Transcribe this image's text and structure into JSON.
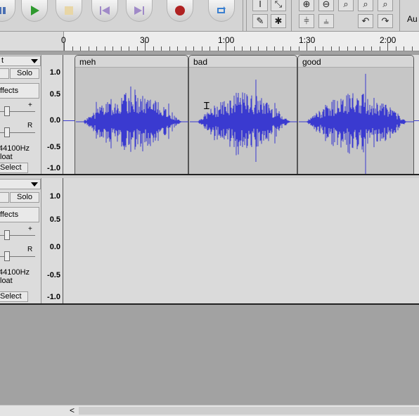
{
  "toolbar": {
    "device_label_partial": "Au"
  },
  "ruler": {
    "labels": [
      "0",
      "30",
      "1:00",
      "1:30",
      "2:00"
    ]
  },
  "tracks": [
    {
      "name_partial": "t",
      "solo_label": "Solo",
      "effects_label": "ffects",
      "gain_plus": "+",
      "pan_right": "R",
      "rate": "44100Hz",
      "format": "loat",
      "select_label": "Select",
      "scale": [
        "1.0",
        "0.5",
        "0.0",
        "-0.5",
        "-1.0"
      ],
      "clips": [
        {
          "name": "meh"
        },
        {
          "name": "bad"
        },
        {
          "name": "good"
        }
      ]
    },
    {
      "solo_label": "Solo",
      "effects_label": "ffects",
      "gain_plus": "+",
      "pan_right": "R",
      "rate": "44100Hz",
      "format": "loat",
      "select_label": "Select",
      "scale": [
        "1.0",
        "0.5",
        "0.0",
        "-0.5",
        "-1.0"
      ]
    }
  ],
  "colors": {
    "waveform": "#3a3ad0",
    "clip_background": "#c6c6c6",
    "record_red": "#b02222",
    "play_green": "#2e9a2e"
  },
  "scrollbar": {
    "left_arrow": "<"
  }
}
